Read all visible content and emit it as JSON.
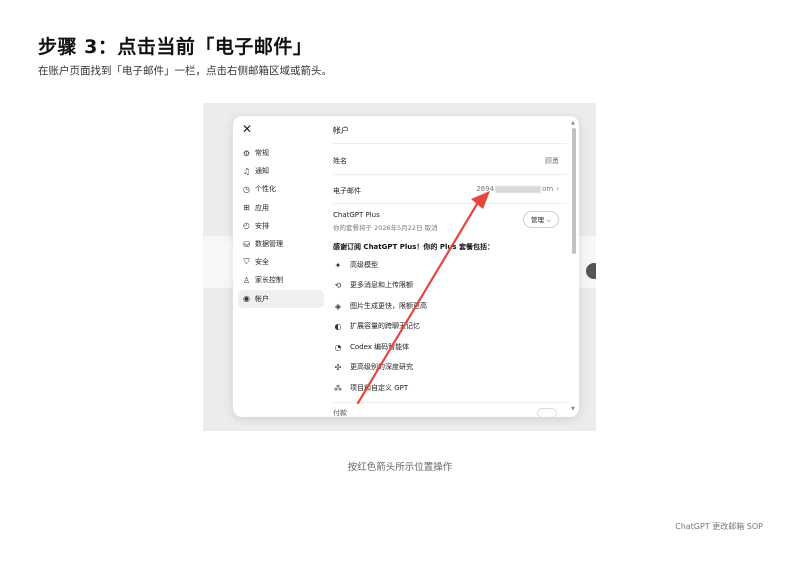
{
  "doc": {
    "title": "步骤 3：点击当前「电子邮件」",
    "subtitle": "在账户页面找到「电子邮件」一栏，点击右侧邮箱区域或箭头。",
    "caption": "按红色箭头所示位置操作",
    "footer": "ChatGPT 更改邮箱 SOP"
  },
  "screenshot": {
    "close_icon": "✕",
    "sidebar": {
      "items": [
        {
          "icon": "gear-icon",
          "glyph": "⚙",
          "label": "常规"
        },
        {
          "icon": "bell-icon",
          "glyph": "🔔",
          "label": "通知"
        },
        {
          "icon": "personalize-icon",
          "glyph": "◷",
          "label": "个性化"
        },
        {
          "icon": "apps-icon",
          "glyph": "⊞",
          "label": "应用"
        },
        {
          "icon": "schedule-icon",
          "glyph": "◴",
          "label": "安排"
        },
        {
          "icon": "data-icon",
          "glyph": "⛁",
          "label": "数据管理"
        },
        {
          "icon": "shield-icon",
          "glyph": "⛉",
          "label": "安全"
        },
        {
          "icon": "parental-icon",
          "glyph": "♙",
          "label": "家长控制"
        },
        {
          "icon": "account-icon",
          "glyph": "◉",
          "label": "帐户"
        }
      ],
      "active_index": 8
    },
    "main": {
      "title": "帐户",
      "name_label": "姓名",
      "name_value": "顾勇",
      "email_label": "电子邮件",
      "email_prefix": "2694",
      "email_suffix": "om",
      "email_chevron": "›",
      "plus_name": "ChatGPT Plus",
      "plus_date": "你的套餐将于 2026年5月22日 取消",
      "manage_label": "管理 ⌵",
      "benefits_head": "感谢订阅 ChatGPT Plus！你的 Plus 套餐包括：",
      "benefits": [
        {
          "icon": "sparkle-icon",
          "glyph": "✦",
          "label": "高级模型"
        },
        {
          "icon": "upload-icon",
          "glyph": "⟲",
          "label": "更多消息和上传限额"
        },
        {
          "icon": "image-icon",
          "glyph": "◈",
          "label": "图片生成更快，限额更高"
        },
        {
          "icon": "memory-icon",
          "glyph": "◐",
          "label": "扩展容量的跨聊天记忆"
        },
        {
          "icon": "codex-icon",
          "glyph": "◔",
          "label": "Codex 编码智能体"
        },
        {
          "icon": "research-icon",
          "glyph": "✣",
          "label": "更高级别的深度研究"
        },
        {
          "icon": "gpt-icon",
          "glyph": "⁂",
          "label": "项目和自定义 GPT"
        }
      ],
      "next_label": "付款"
    },
    "scroll": {
      "up": "▲",
      "down": "▼"
    },
    "bg_icon": "⇅",
    "arrow_color": "#e8453c"
  }
}
